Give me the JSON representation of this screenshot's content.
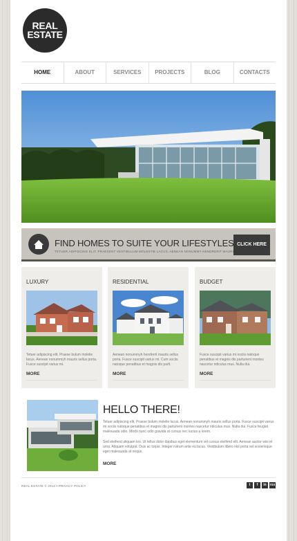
{
  "logo": {
    "line1": "REAL",
    "line2": "ESTATE"
  },
  "nav": [
    "HOME",
    "ABOUT",
    "SERVICES",
    "PROJECTS",
    "BLOG",
    "CONTACTS"
  ],
  "banner": {
    "title": "FIND HOMES TO SUITE YOUR LIFESTYLES!",
    "subtitle": "TETUER ADIPISCING ELIT. PRAESENT VESTIBULUM MOLESTIE LACUS. AENEAN NONUMMY HENDRERIT MAURIS. PHASELLUS PORTA.",
    "button": "CLICK HERE"
  },
  "columns": [
    {
      "heading": "LUXURY",
      "text": "Tetuer adipiscing elit. Praese bulum molelie lacus. Aenean nonummyh mauris sellus porta. Fusce suscipit varius mi.",
      "more": "MORE"
    },
    {
      "heading": "RESIDENTIAL",
      "text": "Aenean nonummyh hendrerit mauris sellus porta. Fusce suscipit varius mi. Cum sociis natoque penatibus et magnis dis partl.",
      "more": "MORE"
    },
    {
      "heading": "BUDGET",
      "text": "Fusce suscipit varius mi sociis natoque penatibus et magnis dis parturient montes nascetur ridiculus mus. Nulla dui.",
      "more": "MORE"
    }
  ],
  "hello": {
    "heading": "HELLO THERE!",
    "p1": "Tetuer adipiscing elit. Praese bulum molelie lacus. Aenean nonummyh mauris sellus porta. Fusce suscipit varius mi sociis natoque penatibus et magnis dis parturient montes nascetur ridiculus mus. Nulla dui. Fusce feugiat malesuada odio. Morbi nunc odio gravida at cursus nec luctus a lorem.",
    "p2": "Sed eleifend aliquam leo. Ut tellus dolor dapibus eget elementum vel cursus eleifend elit. Aenean auctor wisi et urna. Aliquam volutpat. Duis ac turpis. Integer rutrum ante eu lacus. Vestibulum libero nisl porta vel scelerisque eget malesuada at neque.",
    "more": "MORE"
  },
  "footer": "REAL ESTATE © 2012 • PRIVACY POLICY",
  "social": [
    "t",
    "f",
    "in",
    "rss"
  ]
}
